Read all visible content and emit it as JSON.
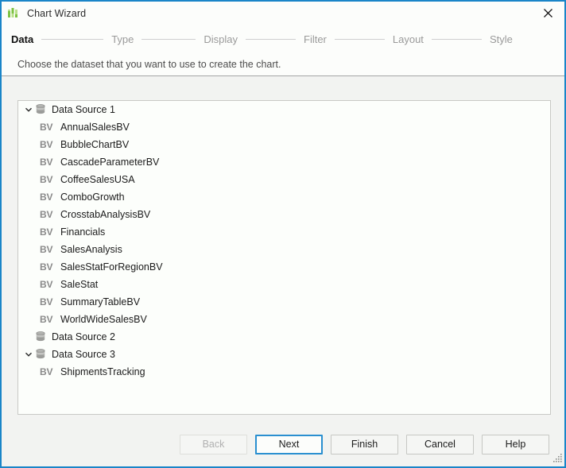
{
  "window": {
    "title": "Chart Wizard",
    "app_icon": "bar-chart-icon",
    "close_label": "×",
    "border_color": "#1a85c8"
  },
  "steps": {
    "items": [
      {
        "label": "Data",
        "active": true
      },
      {
        "label": "Type",
        "active": false
      },
      {
        "label": "Display",
        "active": false
      },
      {
        "label": "Filter",
        "active": false
      },
      {
        "label": "Layout",
        "active": false
      },
      {
        "label": "Style",
        "active": false
      }
    ]
  },
  "description": "Choose the dataset that you want to use to create the chart.",
  "tree": {
    "rows": [
      {
        "label": "Data Source 1",
        "level": 0,
        "icon": "database-icon",
        "expanded": true
      },
      {
        "label": "AnnualSalesBV",
        "level": 1,
        "icon": "bv-icon"
      },
      {
        "label": "BubbleChartBV",
        "level": 1,
        "icon": "bv-icon"
      },
      {
        "label": "CascadeParameterBV",
        "level": 1,
        "icon": "bv-icon"
      },
      {
        "label": "CoffeeSalesUSA",
        "level": 1,
        "icon": "bv-icon"
      },
      {
        "label": "ComboGrowth",
        "level": 1,
        "icon": "bv-icon"
      },
      {
        "label": "CrosstabAnalysisBV",
        "level": 1,
        "icon": "bv-icon"
      },
      {
        "label": "Financials",
        "level": 1,
        "icon": "bv-icon"
      },
      {
        "label": "SalesAnalysis",
        "level": 1,
        "icon": "bv-icon"
      },
      {
        "label": "SalesStatForRegionBV",
        "level": 1,
        "icon": "bv-icon"
      },
      {
        "label": "SaleStat",
        "level": 1,
        "icon": "bv-icon"
      },
      {
        "label": "SummaryTableBV",
        "level": 1,
        "icon": "bv-icon"
      },
      {
        "label": "WorldWideSalesBV",
        "level": 1,
        "icon": "bv-icon"
      },
      {
        "label": "Data Source 2",
        "level": 0,
        "icon": "database-icon",
        "expanded": false
      },
      {
        "label": "Data Source 3",
        "level": 0,
        "icon": "database-icon",
        "expanded": true
      },
      {
        "label": "ShipmentsTracking",
        "level": 1,
        "icon": "bv-icon"
      }
    ],
    "bv_label": "BV"
  },
  "buttons": [
    {
      "label": "Back",
      "state": "disabled"
    },
    {
      "label": "Next",
      "state": "focused"
    },
    {
      "label": "Finish",
      "state": "normal"
    },
    {
      "label": "Cancel",
      "state": "normal"
    },
    {
      "label": "Help",
      "state": "normal"
    }
  ]
}
